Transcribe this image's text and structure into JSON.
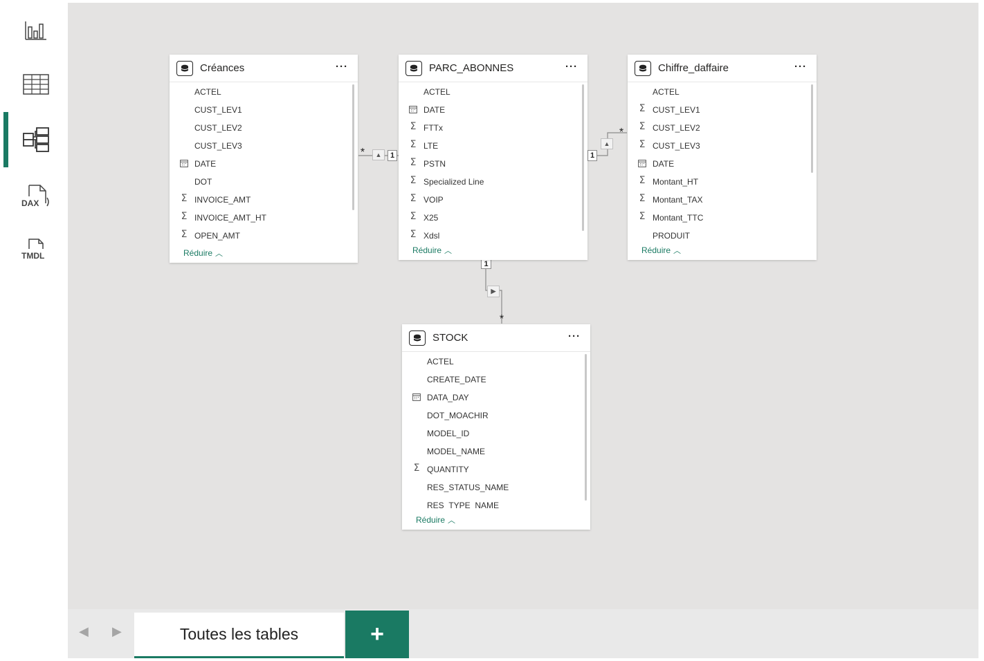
{
  "rail": {
    "items": [
      {
        "name": "report-view",
        "icon": "bar-chart-icon"
      },
      {
        "name": "table-view",
        "icon": "grid-icon"
      },
      {
        "name": "model-view",
        "icon": "model-diagram-icon",
        "active": true
      },
      {
        "name": "dax-query-view",
        "icon": "dax-icon",
        "label": "DAX"
      },
      {
        "name": "tmdl-view",
        "icon": "tmdl-icon",
        "label": "TMDL"
      }
    ]
  },
  "tables": {
    "creances": {
      "title": "Créances",
      "more": "···",
      "reduce": "Réduire",
      "fields": [
        {
          "name": "ACTEL",
          "icon": ""
        },
        {
          "name": "CUST_LEV1",
          "icon": ""
        },
        {
          "name": "CUST_LEV2",
          "icon": ""
        },
        {
          "name": "CUST_LEV3",
          "icon": ""
        },
        {
          "name": "DATE",
          "icon": "calendar"
        },
        {
          "name": "DOT",
          "icon": ""
        },
        {
          "name": "INVOICE_AMT",
          "icon": "sigma"
        },
        {
          "name": "INVOICE_AMT_HT",
          "icon": "sigma"
        },
        {
          "name": "OPEN_AMT",
          "icon": "sigma"
        }
      ]
    },
    "parc": {
      "title": "PARC_ABONNES",
      "more": "···",
      "reduce": "Réduire",
      "fields": [
        {
          "name": "ACTEL",
          "icon": ""
        },
        {
          "name": "DATE",
          "icon": "calendar"
        },
        {
          "name": "FTTx",
          "icon": "sigma"
        },
        {
          "name": "LTE",
          "icon": "sigma"
        },
        {
          "name": "PSTN",
          "icon": "sigma"
        },
        {
          "name": "Specialized Line",
          "icon": "sigma"
        },
        {
          "name": "VOIP",
          "icon": "sigma"
        },
        {
          "name": "X25",
          "icon": "sigma"
        },
        {
          "name": "Xdsl",
          "icon": "sigma"
        }
      ]
    },
    "chiffre": {
      "title": "Chiffre_daffaire",
      "more": "···",
      "reduce": "Réduire",
      "fields": [
        {
          "name": "ACTEL",
          "icon": ""
        },
        {
          "name": "CUST_LEV1",
          "icon": "sigma"
        },
        {
          "name": "CUST_LEV2",
          "icon": "sigma"
        },
        {
          "name": "CUST_LEV3",
          "icon": "sigma"
        },
        {
          "name": "DATE",
          "icon": "calendar"
        },
        {
          "name": "Montant_HT",
          "icon": "sigma"
        },
        {
          "name": "Montant_TAX",
          "icon": "sigma"
        },
        {
          "name": "Montant_TTC",
          "icon": "sigma"
        },
        {
          "name": "PRODUIT",
          "icon": ""
        }
      ]
    },
    "stock": {
      "title": "STOCK",
      "more": "···",
      "reduce": "Réduire",
      "fields": [
        {
          "name": "ACTEL",
          "icon": ""
        },
        {
          "name": "CREATE_DATE",
          "icon": ""
        },
        {
          "name": "DATA_DAY",
          "icon": "calendar"
        },
        {
          "name": "DOT_MOACHIR",
          "icon": ""
        },
        {
          "name": "MODEL_ID",
          "icon": ""
        },
        {
          "name": "MODEL_NAME",
          "icon": ""
        },
        {
          "name": "QUANTITY",
          "icon": "sigma"
        },
        {
          "name": "RES_STATUS_NAME",
          "icon": ""
        },
        {
          "name": "RES_TYPE_NAME",
          "icon": ""
        }
      ]
    }
  },
  "relationships": {
    "many": "*",
    "one": "1"
  },
  "bottom": {
    "tab_all": "Toutes les tables",
    "add": "+"
  },
  "colors": {
    "accent": "#1a7a63",
    "canvas": "#e4e3e2"
  }
}
